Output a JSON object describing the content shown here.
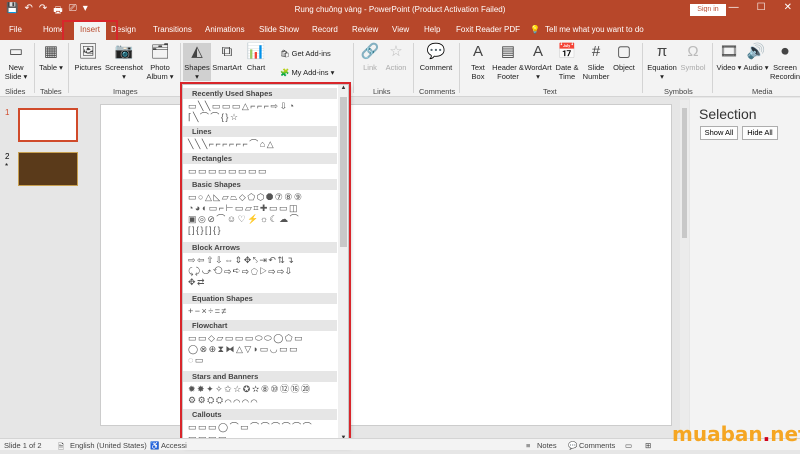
{
  "window": {
    "title": "Rung chuông vàng  -  PowerPoint (Product Activation Failed)",
    "sign_in": "Sign in",
    "quick_access": [
      "💾",
      "↶",
      "↷",
      "🖶",
      "⎚",
      "▾"
    ],
    "controls": [
      "🗔",
      "—",
      "☐",
      "✕"
    ]
  },
  "tabs": [
    "File",
    "Home",
    "Insert",
    "Design",
    "Transitions",
    "Animations",
    "Slide Show",
    "Record",
    "Review",
    "View",
    "Help",
    "Foxit Reader PDF"
  ],
  "tell_me": "Tell me what you want to do",
  "ribbon": {
    "new_slide": "New Slide ▾",
    "table": "Table ▾",
    "pictures": "Pictures",
    "screenshot": "Screenshot ▾",
    "photo_album": "Photo Album ▾",
    "shapes": "Shapes ▾",
    "smartart": "SmartArt",
    "chart": "Chart",
    "get_addins": "Get Add-ins",
    "my_addins": "My Add-ins ▾",
    "link": "Link",
    "action": "Action",
    "comment": "Comment",
    "text_box": "Text Box",
    "header_footer": "Header & Footer",
    "wordart": "WordArt ▾",
    "date_time": "Date & Time",
    "slide_number": "Slide Number",
    "object": "Object",
    "equation": "Equation ▾",
    "symbol": "Symbol",
    "video": "Video ▾",
    "audio": "Audio ▾",
    "screen_recording": "Screen Recording",
    "groups": [
      "Slides",
      "Tables",
      "Images",
      "Links",
      "Comments",
      "Text",
      "Symbols",
      "Media"
    ]
  },
  "slides": {
    "n1": "1",
    "n2": "2",
    "star": "*"
  },
  "selection_pane": {
    "title": "Selection",
    "show_all": "Show All",
    "hide_all": "Hide All"
  },
  "shapes_menu": {
    "categories": [
      "Recently Used Shapes",
      "Lines",
      "Rectangles",
      "Basic Shapes",
      "Block Arrows",
      "Equation Shapes",
      "Flowchart",
      "Stars and Banners",
      "Callouts"
    ],
    "rows": [
      "▭╲╲▭▭▭△⌐⌐⌐⇨⇩◔",
      "⌈╲⌒⌒{}☆",
      "╲╲╲⌐⌐⌐⌐⌐⌐⌒⌂△",
      "▭▭▭▭▭▭▭▭",
      "▭○△◺▱⏢◇⬠⬡⯃⑦⑧⑨",
      "◔◕◐▭⌐⊢▭▱⌗✚▭▭◫",
      "▣◎⊘⌒☺♡⚡☼☾☁⌒",
      "[]{}[]{}",
      "⇨⇦⇧⇩⇔⇕✥⤣⇥↶⇅↴",
      "⤹⤸⤻⟲⇨➪⇨⬠▷⇨⇨⇩",
      "✥⇄",
      "+−×÷=≠",
      "▭▭◇▱▭▭▭⬭⬭◯⬠▭",
      "◯⊗⊕⧗⧓△▽◗▭◡▭▭",
      "◌▭",
      "✹✸✦✧✩☆✪✫⑧⑩⑫⑯⑳",
      "⚙⚙⛭⛭⌒⌒⌒⌒",
      "▭▭▭◯⌒▭⌒⌒⌒⌒⌒⌒",
      "▭▭▭▭"
    ]
  },
  "status": {
    "slide": "Slide 1 of 2",
    "language": "English (United States)",
    "access": "Accessi",
    "notes": "Notes",
    "comments": "Comments"
  },
  "watermark": {
    "brand": "muaban",
    "dot": ".",
    "tld": "net"
  },
  "colors": {
    "accent": "#b7472a",
    "highlight": "#d8262b"
  }
}
